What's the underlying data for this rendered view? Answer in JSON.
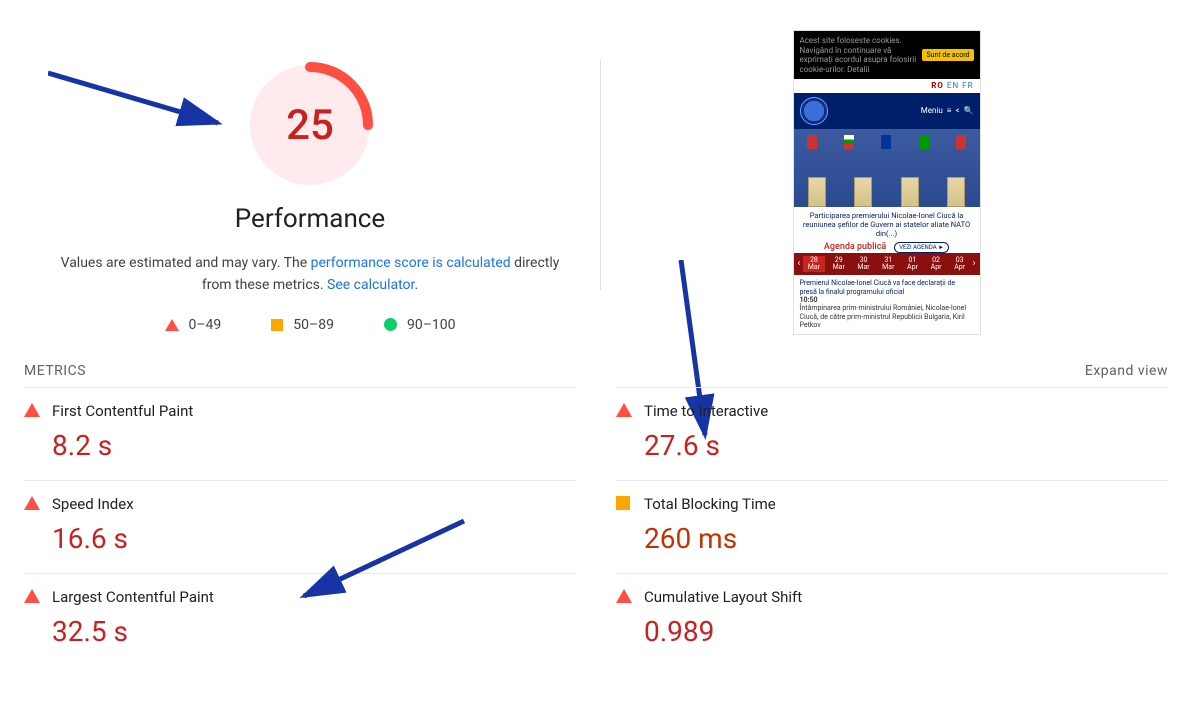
{
  "gauge": {
    "score": "25",
    "label": "Performance"
  },
  "description": {
    "pre": "Values are estimated and may vary. The ",
    "link1": "performance score is calculated",
    "mid": " directly from these metrics. ",
    "link2": "See calculator"
  },
  "legend": {
    "poor": "0–49",
    "avg": "50–89",
    "good": "90–100"
  },
  "metrics_header": "METRICS",
  "expand": "Expand view",
  "metrics": {
    "fcp": {
      "name": "First Contentful Paint",
      "value": "8.2 s",
      "status": "red"
    },
    "si": {
      "name": "Speed Index",
      "value": "16.6 s",
      "status": "red"
    },
    "lcp": {
      "name": "Largest Contentful Paint",
      "value": "32.5 s",
      "status": "red"
    },
    "tti": {
      "name": "Time to Interactive",
      "value": "27.6 s",
      "status": "red"
    },
    "tbt": {
      "name": "Total Blocking Time",
      "value": "260 ms",
      "status": "orange"
    },
    "cls": {
      "name": "Cumulative Layout Shift",
      "value": "0.989",
      "status": "red"
    }
  },
  "thumb": {
    "cookie_text": "Acest site foloseste cookies. Navigând în continuare vă exprimați acordul asupra folosirii cookie-urilor. Detalii",
    "cookie_btn": "Sunt de acord",
    "lang": {
      "ro": "RO",
      "en": "EN",
      "fr": "FR"
    },
    "menu": "Meniu",
    "caption": "Participarea premierului Nicolae-Ionel Ciucă la reuniunea șefilor de Guvern ai statelor aliate NATO din(...)",
    "agenda": "Agenda publică",
    "agenda_btn": "VEZI AGENDA ►",
    "cal": [
      "28 Mar",
      "29 Mar",
      "30 Mar",
      "31 Mar",
      "01 Apr",
      "02 Apr",
      "03 Apr"
    ],
    "below1": "Premierul Nicolae-Ionel Ciucă va face declarații de presă la finalul programului oficial",
    "time": "10:50",
    "below2": "Întâmpinarea prim-ministrului României, Nicolae-Ionel Ciucă, de către prim-ministrul Republicii Bulgaria, Kiril Petkov"
  }
}
